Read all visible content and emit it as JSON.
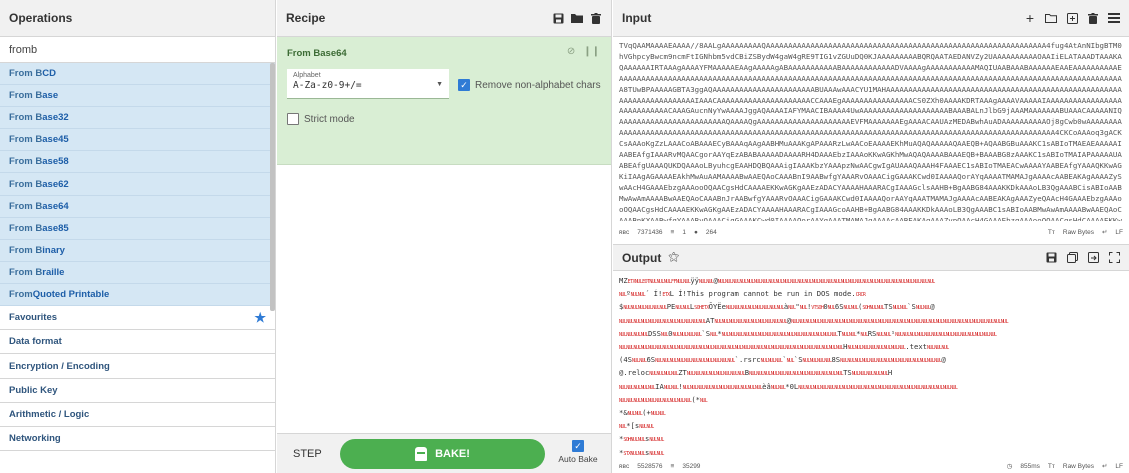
{
  "operations": {
    "title": "Operations",
    "search_value": "fromb",
    "items": [
      {
        "pre": "From B",
        "rest": "CD"
      },
      {
        "pre": "From B",
        "rest": "ase"
      },
      {
        "pre": "From B",
        "rest": "ase32"
      },
      {
        "pre": "From B",
        "rest": "ase45"
      },
      {
        "pre": "From B",
        "rest": "ase58"
      },
      {
        "pre": "From B",
        "rest": "ase62"
      },
      {
        "pre": "From B",
        "rest": "ase64"
      },
      {
        "pre": "From B",
        "rest": "ase85"
      },
      {
        "pre": "From B",
        "rest": "inary"
      },
      {
        "pre": "From B",
        "rest": "raille"
      },
      {
        "pre": "From ",
        "rest": "Quoted Printable"
      }
    ],
    "categories": [
      "Favourites",
      "Data format",
      "Encryption / Encoding",
      "Public Key",
      "Arithmetic / Logic",
      "Networking"
    ],
    "favourites_icon": "star-icon"
  },
  "recipe": {
    "title": "Recipe",
    "header_icons": [
      "save-icon",
      "folder-icon",
      "trash-icon"
    ],
    "operation": {
      "name": "From Base64",
      "controls": [
        "disable-icon",
        "pause-icon"
      ],
      "alphabet_label": "Alphabet",
      "alphabet_value": "A-Za-z0-9+/=",
      "remove_nonalpha_label": "Remove non-alphabet chars",
      "remove_nonalpha_checked": true,
      "strict_mode_label": "Strict mode",
      "strict_mode_checked": false
    },
    "step_label": "STEP",
    "bake_label": "BAKE!",
    "auto_bake_label": "Auto Bake",
    "auto_bake_checked": true
  },
  "input": {
    "title": "Input",
    "header_icons": [
      "plus-icon",
      "new-folder-icon",
      "import-icon",
      "trash-icon",
      "layout-icon"
    ],
    "text": "TVqQAAMAAAAEAAAA//8AALgAAAAAAAAAQAAAAAAAAAAAAAAAAAAAAAAAAAAAAAAAAAAAAAAAAAAAAAAAAAAAAAAAAAAAAAAA4fug4AtAnNIbgBTM0hVGhpcyBwcm9ncmFtIGNhbm5vdCBiZSBydW4gaW4gRE9TIG1vZGUuDQ0KJAAAAAAAAABQRQAATAEDANVZy2UAAAAAAAAAAOAAIiELATAAADTAAAKAQAAAAAAIRTAAAgAAAAYFMAAAAAEAAgAAAAAgABAAAAAAAAAAABAAAAAAAAAAAADVAAAAgAAAAAAAAAAAMAQIUAABAAABAAAAAAEAAEAAAAAAAAAAEAAAAAAAAAAAAAAAAAAAAAAAAAAAAAAAAAAAAAAAAAAAAAAAAAAAAAAAAAAAAAAAAAAAAAAAAAAAAAAAAAAAAAAAAAAAAAAAAAAAAAAAAAAAAAAAAAA8TUwBPAAAAAGBTA3ggAQAAAAAAAAAAAAAAAAAAAAAAABUAAAwAAACYU1MAHAAAAAAAAAAAAAAAAAAAAAAAAAAAAAAAAAAAAAAAAAAAAAAAAAAAAAAAAAAAAAAAAAAAAAAIAAACAAAAAAAAAAAAAAAAAAAAACCAAAEgAAAAAAAAAAAAAAAACS0ZXh0AAAAKDRTAAAgAAAAVAAAAAIAAAAAAAAAAAAAAAAAAAAAAAAAAAACAAAGAucnNyYwAAAAJggAQAAAAIAFYMAACIBAAAA4UwAAAAAAAAAAAAAAAAAAAABAAABALnJlbG9jAAAMAAAAAAABUAAACAAAAANIQAAAAAAAAAAAAAAAAAAAAAAAAQAAAAQgAAAAAAAAAAAAAAAAAAAAAEVFMAAAAAAAEgAAAACAAUAzMEDABwhAuADAAAAAAAAAAOj8gCwb0wAAAAAAAAAAAAAAAAAAAAAAAAAAAAAAAAAAAAAAAAAAAAAAAAAAAAAAAAAAAAAAAAAAAAAAAAAAAAAAAAAAAAAAAAAAAAAAAAAAAAAAAAAA4CKCoAAAoq3gACKCsAAAoKgZzLAAACoABAAAECyBAAAqAAgAABHMuAAAKgAPAAARzLwAACoEAAAAEKhMuAQAQAAAAAQAAEQB+AQAABGBuAAAKC1sABIoTMAEAEAAAAAIAABEAfgIAAARvMQAACgorAAYqEzABABAAAAADAAAARH4DAAAEbzIAAAoKKwAGKhMwAQAQAAAABAAAEQB+BAAABG8zAAAKC1sABIoTMAIAPAAAAAUAABEAfgUAAAQUKDQAAAoLByuhcgEAAHDQBQAAAigIAAAKbzYAAApzNwAACgwIgAUAAAQAAAH4FAAAEC1sABIoTMAEACwAAAAYAABEAfgYAAAQKKwAGKiIAAgAGAAAAEAkhMwAuAAMAAAABwAAEQAoCAAABnI9AABwfgYAAARvOAAACigGAAAKCwd0IAAAAQorAYqAAAATMAMAJgAAAAcAABEAKAgAAAAZySwAAcH4GAAAEbzgAAAooOQAACgsHdCAAAAEKKwAGKgAAEzADACYAAAAHAAARACgIAAAGclsAAHB+BgAABG84AAAKKDkAAAoLB3QgAAABCisABIoAABMwAwAmAAAABwAAEQAoCAAABnJrAABwfgYAAARvOAAACigGAAAKCwd0IAAAAQorAAYqAAATMAMAJgAAAAcAABEAKAgAAAZyeQAAcH4GAAAEbzgAAAooOQAACgsHdCAAAAEKKwAGKgAAEzADACYAAAAHAAARACgIAAAGcoAAHB+BgAABG84AAAKKDkAAAoLB3QgAAABC1sABIoAABMwAwAmAAAABwAAEQAoCAAABnKXAABwfgYAAARvOAAACigGAAAKCwd0IAAAAQorAAYqAAATMAMAJgAAAAcAABEAKAgAAAZypQAAcH4GAAAEbzgAAAooOQAACgsHdCAAAAEKKwAGKgAAEzADACYAAAAHAAARACgIAAAGcoAAHB+BgAABG84AAAKKDkAAAoLB3QgAAABC1sA",
    "status_len": "7371436",
    "status_lines": "1",
    "status_pos": "264",
    "status_right": "Raw Bytes",
    "status_eol": "LF"
  },
  "output": {
    "title": "Output",
    "header_icons": [
      "magic-wand-icon",
      "save-icon",
      "copy-icon",
      "replace-input-icon",
      "fullscreen-icon"
    ],
    "lines": [
      [
        [
          "MZ",
          "t"
        ],
        [
          "ETXNULEOTNULNULNULFFNULNUL",
          "c"
        ],
        [
          "ÿÿ",
          "t"
        ],
        [
          "NULNUL",
          "c"
        ],
        [
          "@",
          "t"
        ],
        [
          "NULNULNULNULNULNULNULNULNULNULNULNULNULNULNULNULNULNULNULNULNULNULNULNULNULNULNULNULNULNUL",
          "c"
        ]
      ],
      [
        [
          "NUL",
          "c"
        ],
        [
          "º",
          "t"
        ],
        [
          "NULNUL",
          "c"
        ],
        [
          "´",
          "t"
        ],
        [
          "  Í!",
          "t"
        ],
        [
          "ETX",
          "c"
        ],
        [
          "L Í!This program cannot be run in DOS mode.",
          "t"
        ],
        [
          "CRCR",
          "c"
        ]
      ],
      [
        [
          "$",
          "t"
        ],
        [
          "NULNULNULNULNULNUL",
          "c"
        ],
        [
          "PE",
          "t"
        ],
        [
          "NULNUL",
          "c"
        ],
        [
          "L",
          "t"
        ],
        [
          "SOHETX",
          "c"
        ],
        [
          "ÕYËe",
          "t"
        ],
        [
          "NULNULNULNULNULNULNULNUL",
          "c"
        ],
        [
          "à",
          "t"
        ],
        [
          "NUL",
          "c"
        ],
        [
          "\"",
          "t"
        ],
        [
          "NUL",
          "c"
        ],
        [
          "!",
          "t"
        ],
        [
          "VTSOH",
          "c"
        ],
        [
          "0",
          "t"
        ],
        [
          "NUL",
          "c"
        ],
        [
          "6S",
          "t"
        ],
        [
          "NULNUL",
          "c"
        ],
        [
          "(",
          "t"
        ],
        [
          "SOHNULNUL",
          "c"
        ],
        [
          "TS",
          "t"
        ],
        [
          "NULNUL",
          "c"
        ],
        [
          "`S",
          "t"
        ],
        [
          "NULNUL",
          "c"
        ],
        [
          "@",
          "t"
        ]
      ],
      [
        [
          "NULNULNULNULNULNULNULNULNULNULNULNUL",
          "c"
        ],
        [
          "AT",
          "t"
        ],
        [
          "NULNULNULNULNULNULNULNULNULNUL",
          "c"
        ],
        [
          "@",
          "t"
        ],
        [
          "NULNULNULNULNULNULNULNULNULNULNULNULNULNULNULNULNULNULNULNULNULNULNULNULNULNULNULNULNULNUL",
          "c"
        ]
      ],
      [
        [
          "NULNULNULNUL",
          "c"
        ],
        [
          "DSS",
          "t"
        ],
        [
          "NUL",
          "c"
        ],
        [
          "0",
          "t"
        ],
        [
          "NULNULNULNUL",
          "c"
        ],
        [
          "`S",
          "t"
        ],
        [
          "NUL",
          "c"
        ],
        [
          "*",
          "t"
        ],
        [
          "NULNULNULNULNULNULNULNULNULNULNULNULNULNULNULNUL",
          "c"
        ],
        [
          "T",
          "t"
        ],
        [
          "NULNUL",
          "c"
        ],
        [
          "*",
          "t"
        ],
        [
          "NUL",
          "c"
        ],
        [
          "RS",
          "t"
        ],
        [
          "NULNUL",
          "c"
        ],
        [
          "¹",
          "t"
        ],
        [
          "NULNULNULNULNULNULNULNULNULNULNULNULNULNUL",
          "c"
        ]
      ],
      [
        [
          "NULNULNULNULNULNULNULNULNULNULNULNULNULNULNULNULNULNULNULNULNULNULNULNULNULNULNULNULNULNULNUL",
          "c"
        ],
        [
          "H",
          "t"
        ],
        [
          "NULNULNULNULNULNULNULNUL",
          "c"
        ],
        [
          ".text",
          "t"
        ],
        [
          "NULNULNUL",
          "c"
        ]
      ],
      [
        [
          "(4S",
          "t"
        ],
        [
          "NULNUL",
          "c"
        ],
        [
          "6S",
          "t"
        ],
        [
          "NULNULNULNULNULNULNULNULNULNULNUL",
          "c"
        ],
        [
          "`",
          "t"
        ],
        [
          ".rsrc",
          "t"
        ],
        [
          "NULNULNUL",
          "c"
        ],
        [
          "`",
          "t"
        ],
        [
          "NUL",
          "c"
        ],
        [
          "`S",
          "t"
        ],
        [
          "NULNULNULNUL",
          "c"
        ],
        [
          "8S",
          "t"
        ],
        [
          "NULNULNULNULNULNULNULNULNULNULNULNULNULNUL",
          "c"
        ],
        [
          "@",
          "t"
        ]
      ],
      [
        [
          "@.reloc",
          "t"
        ],
        [
          "NULNULNULNUL",
          "c"
        ],
        [
          "ZT",
          "t"
        ],
        [
          "NULNULNULNULNULNULNULNUL",
          "c"
        ],
        [
          "B",
          "t"
        ],
        [
          "NULNULNULNULNULNULNULNULNULNULNULNULNUL",
          "c"
        ],
        [
          "TS",
          "t"
        ],
        [
          "NULNULNULNULNUL",
          "c"
        ],
        [
          "H",
          "t"
        ]
      ],
      [
        [
          "NULNULNULNULNUL",
          "c"
        ],
        [
          "IA",
          "t"
        ],
        [
          "NULNUL",
          "c"
        ],
        [
          "!",
          "t"
        ],
        [
          "NULNULNULNULNULNULNULNULNULNULNUL",
          "c"
        ],
        [
          "èâ",
          "t"
        ],
        [
          "NULNUL",
          "c"
        ],
        [
          "*0L",
          "t"
        ],
        [
          "NULNULNULNULNULNULNULNULNULNULNULNULNULNULNULNULNULNULNULNULNULNUL",
          "c"
        ]
      ],
      [
        [
          "NULNULNULNULNULNULNULNULNULNUL",
          "c"
        ],
        [
          "(*",
          "t"
        ],
        [
          "NUL",
          "c"
        ]
      ],
      [
        [
          "*&",
          "t"
        ],
        [
          "NULNUL",
          "c"
        ],
        [
          "(+",
          "t"
        ],
        [
          "NULNUL",
          "c"
        ]
      ],
      [
        [
          "NUL",
          "c"
        ],
        [
          "*[s",
          "t"
        ],
        [
          "NULNUL",
          "c"
        ]
      ],
      [
        [
          "*",
          "t"
        ],
        [
          "SOHNULNUL",
          "c"
        ],
        [
          "s",
          "t"
        ],
        [
          "NULNUL",
          "c"
        ]
      ],
      [
        [
          "*",
          "t"
        ],
        [
          "STXNULNUL",
          "c"
        ],
        [
          "s",
          "t"
        ],
        [
          "NULNUL",
          "c"
        ]
      ],
      [
        [
          "*",
          "t"
        ],
        [
          "ETXNULNUL",
          "c"
        ],
        [
          "s/",
          "t"
        ],
        [
          "NULNUL",
          "c"
        ]
      ],
      [
        [
          "*",
          "t"
        ],
        [
          "EOTNULNUL",
          "c"
        ],
        [
          "*",
          "t"
        ],
        [
          "NULNULNULNULNULNULNULNULNULNUL",
          "c"
        ],
        [
          "e0",
          "t"
        ],
        [
          "NULNUL",
          "c"
        ]
      ]
    ],
    "status_len": "5528576",
    "status_lines": "35299",
    "status_time": "855ms",
    "status_right": "Raw Bytes",
    "status_eol": "LF"
  }
}
